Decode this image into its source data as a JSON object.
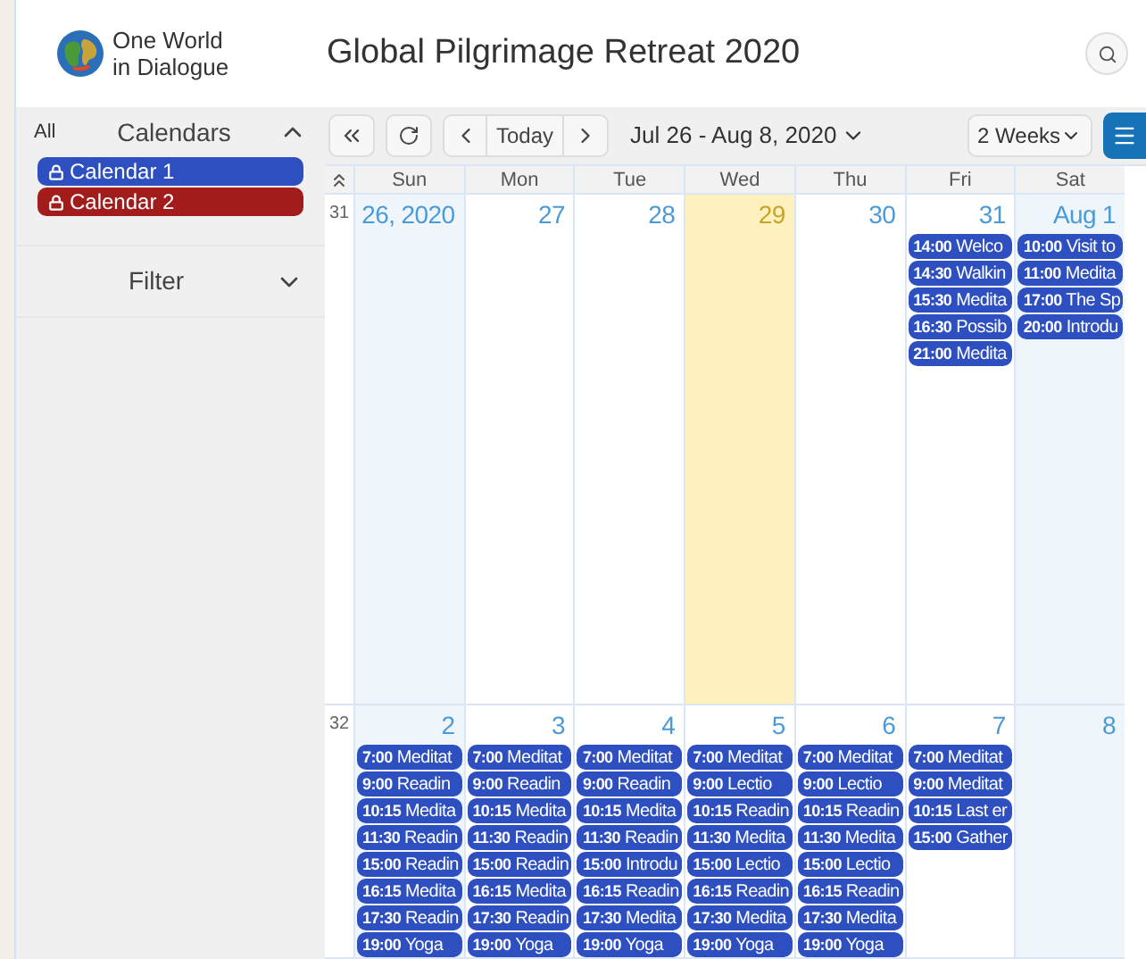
{
  "logo": {
    "line1": "One World",
    "line2": "in Dialogue"
  },
  "title": "Global Pilgrimage Retreat 2020",
  "sidebar": {
    "all": "All",
    "calendars_heading": "Calendars",
    "calendars_expanded": true,
    "calendars": [
      {
        "name": "Calendar 1",
        "color": "#2d4fbf"
      },
      {
        "name": "Calendar 2",
        "color": "#a31c1c"
      }
    ],
    "filter_heading": "Filter",
    "filter_expanded": false
  },
  "toolbar": {
    "today": "Today",
    "range": "Jul 26 - Aug 8, 2020",
    "view": "2 Weeks"
  },
  "weekdays": [
    "Sun",
    "Mon",
    "Tue",
    "Wed",
    "Thu",
    "Fri",
    "Sat"
  ],
  "weeks": [
    {
      "number": "31",
      "days": [
        {
          "label": "26, 2020",
          "today": false,
          "weekend": true
        },
        {
          "label": "27",
          "today": false,
          "weekend": false
        },
        {
          "label": "28",
          "today": false,
          "weekend": false
        },
        {
          "label": "29",
          "today": true,
          "weekend": false
        },
        {
          "label": "30",
          "today": false,
          "weekend": false
        },
        {
          "label": "31",
          "today": false,
          "weekend": false,
          "events": [
            {
              "time": "14:00",
              "title": "Welco"
            },
            {
              "time": "14:30",
              "title": "Walkin"
            },
            {
              "time": "15:30",
              "title": "Medita"
            },
            {
              "time": "16:30",
              "title": "Possib"
            },
            {
              "time": "21:00",
              "title": "Medita"
            }
          ]
        },
        {
          "label": "Aug 1",
          "today": false,
          "weekend": true,
          "events": [
            {
              "time": "10:00",
              "title": "Visit to"
            },
            {
              "time": "11:00",
              "title": "Medita"
            },
            {
              "time": "17:00",
              "title": "The Sp"
            },
            {
              "time": "20:00",
              "title": "Introdu"
            }
          ]
        }
      ]
    },
    {
      "number": "32",
      "days": [
        {
          "label": "2",
          "today": false,
          "weekend": true,
          "events": [
            {
              "time": "7:00",
              "title": "Meditat"
            },
            {
              "time": "9:00",
              "title": "Readin"
            },
            {
              "time": "10:15",
              "title": "Medita"
            },
            {
              "time": "11:30",
              "title": "Readin"
            },
            {
              "time": "15:00",
              "title": "Readin"
            },
            {
              "time": "16:15",
              "title": "Medita"
            },
            {
              "time": "17:30",
              "title": "Readin"
            },
            {
              "time": "19:00",
              "title": "Yoga"
            }
          ]
        },
        {
          "label": "3",
          "today": false,
          "weekend": false,
          "events": [
            {
              "time": "7:00",
              "title": "Meditat"
            },
            {
              "time": "9:00",
              "title": "Readin"
            },
            {
              "time": "10:15",
              "title": "Medita"
            },
            {
              "time": "11:30",
              "title": "Readin"
            },
            {
              "time": "15:00",
              "title": "Readin"
            },
            {
              "time": "16:15",
              "title": "Medita"
            },
            {
              "time": "17:30",
              "title": "Readin"
            },
            {
              "time": "19:00",
              "title": "Yoga"
            }
          ]
        },
        {
          "label": "4",
          "today": false,
          "weekend": false,
          "events": [
            {
              "time": "7:00",
              "title": "Meditat"
            },
            {
              "time": "9:00",
              "title": "Readin"
            },
            {
              "time": "10:15",
              "title": "Medita"
            },
            {
              "time": "11:30",
              "title": "Readin"
            },
            {
              "time": "15:00",
              "title": "Introdu"
            },
            {
              "time": "16:15",
              "title": "Readin"
            },
            {
              "time": "17:30",
              "title": "Medita"
            },
            {
              "time": "19:00",
              "title": "Yoga"
            }
          ]
        },
        {
          "label": "5",
          "today": false,
          "weekend": false,
          "events": [
            {
              "time": "7:00",
              "title": "Meditat"
            },
            {
              "time": "9:00",
              "title": "Lectio"
            },
            {
              "time": "10:15",
              "title": "Readin"
            },
            {
              "time": "11:30",
              "title": "Medita"
            },
            {
              "time": "15:00",
              "title": "Lectio"
            },
            {
              "time": "16:15",
              "title": "Readin"
            },
            {
              "time": "17:30",
              "title": "Medita"
            },
            {
              "time": "19:00",
              "title": "Yoga"
            }
          ]
        },
        {
          "label": "6",
          "today": false,
          "weekend": false,
          "events": [
            {
              "time": "7:00",
              "title": "Meditat"
            },
            {
              "time": "9:00",
              "title": "Lectio"
            },
            {
              "time": "10:15",
              "title": "Readin"
            },
            {
              "time": "11:30",
              "title": "Medita"
            },
            {
              "time": "15:00",
              "title": "Lectio"
            },
            {
              "time": "16:15",
              "title": "Readin"
            },
            {
              "time": "17:30",
              "title": "Medita"
            },
            {
              "time": "19:00",
              "title": "Yoga"
            }
          ]
        },
        {
          "label": "7",
          "today": false,
          "weekend": false,
          "events": [
            {
              "time": "7:00",
              "title": "Meditat"
            },
            {
              "time": "9:00",
              "title": "Meditat"
            },
            {
              "time": "10:15",
              "title": "Last er"
            },
            {
              "time": "15:00",
              "title": "Gather"
            }
          ]
        },
        {
          "label": "8",
          "today": false,
          "weekend": true
        }
      ]
    }
  ]
}
